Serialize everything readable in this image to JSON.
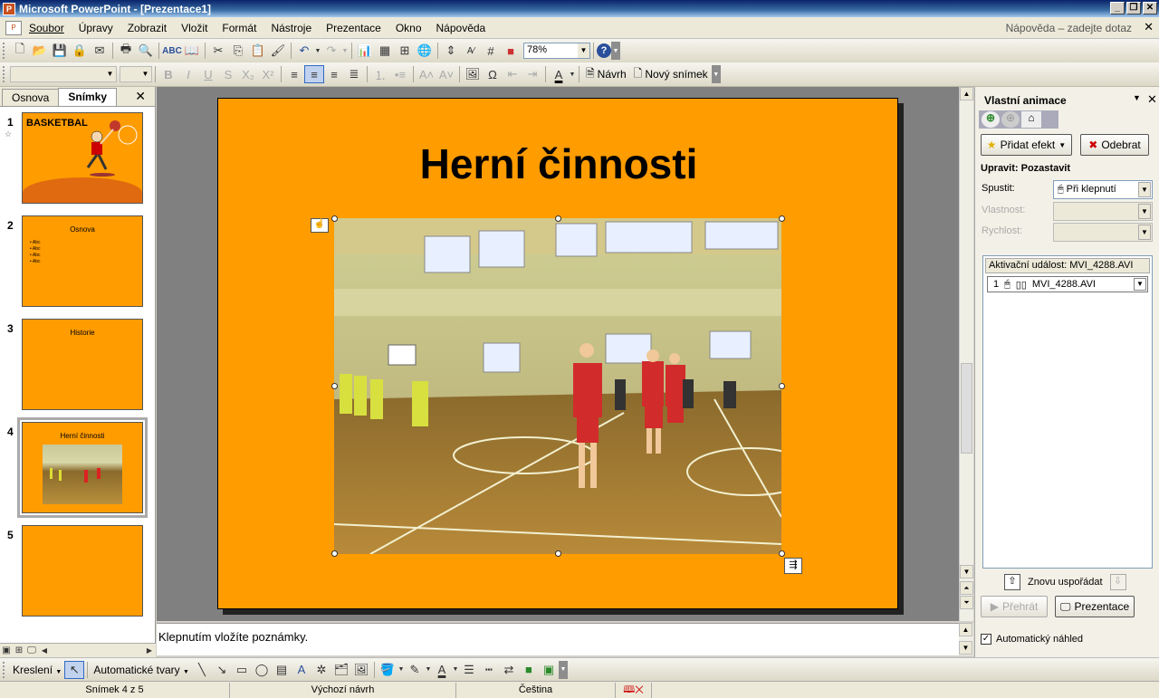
{
  "window": {
    "title": "Microsoft PowerPoint - [Prezentace1]"
  },
  "menu": {
    "items": [
      "Soubor",
      "Úpravy",
      "Zobrazit",
      "Vložit",
      "Formát",
      "Nástroje",
      "Prezentace",
      "Okno",
      "Nápověda"
    ],
    "help_box": "Nápověda – zadejte dotaz"
  },
  "toolbar": {
    "zoom": "78%"
  },
  "formatting": {
    "design_label": "Návrh",
    "new_slide_label": "Nový snímek"
  },
  "left_panel": {
    "tabs": [
      "Osnova",
      "Snímky"
    ],
    "slides": [
      {
        "num": "1",
        "title": "BASKETBAL"
      },
      {
        "num": "2",
        "title": "Osnova",
        "bullets": [
          "Abc",
          "Abc",
          "Abc",
          "Abc"
        ]
      },
      {
        "num": "3",
        "title": "Historie"
      },
      {
        "num": "4",
        "title": "Herní činnosti"
      },
      {
        "num": "5",
        "title": ""
      }
    ]
  },
  "slide": {
    "title": "Herní činnosti"
  },
  "notes": {
    "placeholder": "Klepnutím vložíte poznámky."
  },
  "task_pane": {
    "title": "Vlastní animace",
    "add_effect": "Přidat efekt",
    "remove": "Odebrat",
    "modify_label": "Upravit: Pozastavit",
    "start_label": "Spustit:",
    "start_value": "Při klepnutí",
    "property_label": "Vlastnost:",
    "speed_label": "Rychlost:",
    "trigger_label": "Aktivační událost: MVI_4288.AVI",
    "item_number": "1",
    "item_name": "MVI_4288.AVI",
    "reorder_label": "Znovu uspořádat",
    "play_label": "Přehrát",
    "slideshow_label": "Prezentace",
    "autopreview_label": "Automatický náhled"
  },
  "drawing": {
    "draw_label": "Kreslení",
    "autoshapes_label": "Automatické tvary"
  },
  "status": {
    "slide_of": "Snímek 4 z 5",
    "design": "Výchozí návrh",
    "language": "Čeština"
  },
  "colors": {
    "slide_bg": "#ff9c00",
    "canvas": "#808080"
  }
}
